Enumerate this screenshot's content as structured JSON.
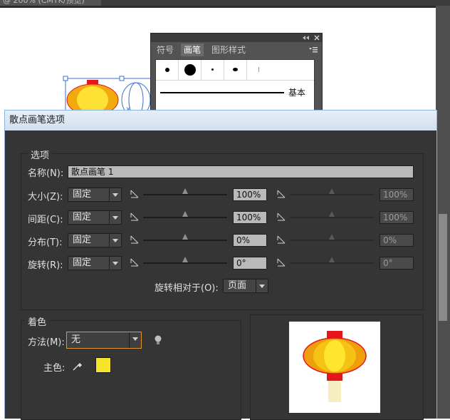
{
  "document": {
    "tab_title": "@ 200% (CMYK/预览)"
  },
  "brush_panel": {
    "tabs": [
      "符号",
      "画笔",
      "图形样式"
    ],
    "basic_label": "基本"
  },
  "dialog": {
    "title": "散点画笔选项",
    "options_group": "选项",
    "name_label": "名称(N):",
    "name_value": "散点画笔 1",
    "rows": [
      {
        "label": "大小(Z):",
        "method": "固定",
        "value1": "100%",
        "value2": "100%"
      },
      {
        "label": "间距(C):",
        "method": "固定",
        "value1": "100%",
        "value2": "100%"
      },
      {
        "label": "分布(T):",
        "method": "固定",
        "value1": "0%",
        "value2": "0%"
      },
      {
        "label": "旋转(R):",
        "method": "固定",
        "value1": "0°",
        "value2": "0°"
      }
    ],
    "rotation_relative_label": "旋转相对于(O):",
    "rotation_relative_value": "页面",
    "coloring_group": "着色",
    "method_label": "方法(M):",
    "method_value": "无",
    "key_color_label": "主色:",
    "key_color": "#f5e32c"
  },
  "colors": {
    "accent_border": "#e0962a",
    "lantern_red": "#e3161b",
    "lantern_yellow": "#ffd21f"
  }
}
